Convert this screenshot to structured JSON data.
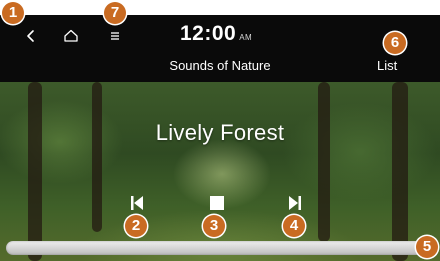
{
  "colors": {
    "topbar": "#0a0a0a",
    "badge": "#c96b22",
    "text": "#ffffff"
  },
  "header": {
    "time": "12:00",
    "ampm": "AM",
    "source_title": "Sounds of Nature",
    "list_label": "List",
    "icons": {
      "back": "chevron-left-icon",
      "home": "home-icon",
      "menu": "menu-icon"
    }
  },
  "player": {
    "track_title": "Lively Forest",
    "controls": [
      "skip-back-icon",
      "stop-icon",
      "skip-forward-icon"
    ],
    "progress": 0.0
  },
  "callouts": [
    "1",
    "2",
    "3",
    "4",
    "5",
    "6",
    "7"
  ]
}
